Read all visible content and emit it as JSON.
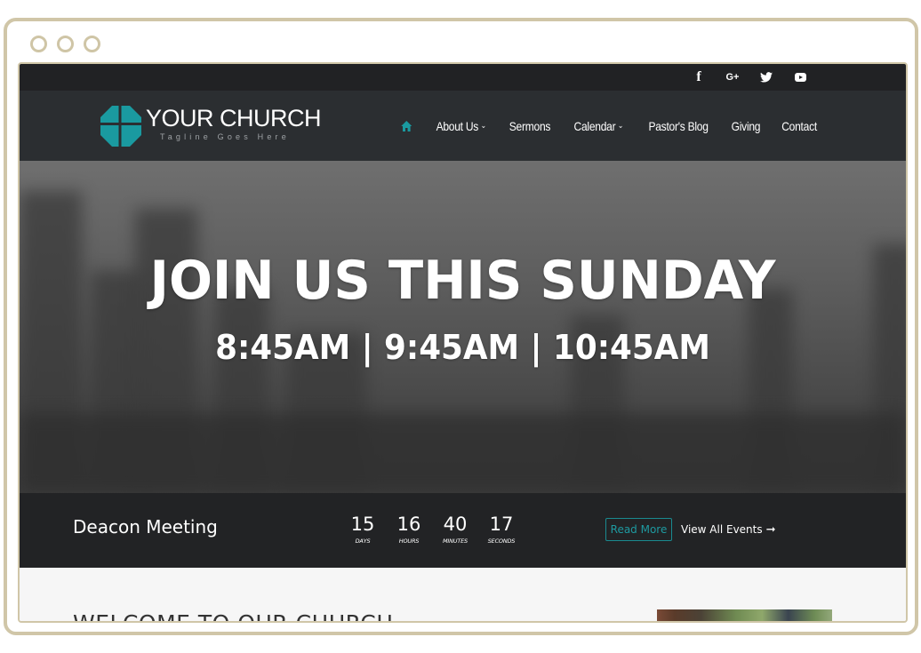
{
  "window": {
    "controls": [
      "dot-1",
      "dot-2",
      "dot-3"
    ]
  },
  "social": {
    "icons": [
      {
        "name": "facebook-icon",
        "glyph": "f"
      },
      {
        "name": "google-plus-icon",
        "glyph": "G+"
      },
      {
        "name": "twitter-icon",
        "glyph": "bird"
      },
      {
        "name": "youtube-icon",
        "glyph": "play"
      }
    ]
  },
  "brand": {
    "title": "YOUR CHURCH",
    "tagline": "Tagline Goes Here",
    "accent_color": "#1a9aa0"
  },
  "nav": {
    "home_icon": "home-icon",
    "items": [
      {
        "label": "About Us",
        "has_dropdown": true,
        "caret": "⌄"
      },
      {
        "label": "Sermons",
        "has_dropdown": false
      },
      {
        "label": "Calendar",
        "has_dropdown": true,
        "caret": "⌄"
      },
      {
        "label": "Pastor's Blog",
        "has_dropdown": false
      },
      {
        "label": "Giving",
        "has_dropdown": false
      },
      {
        "label": "Contact",
        "has_dropdown": false
      }
    ]
  },
  "hero": {
    "title": "JOIN US THIS SUNDAY",
    "times": "8:45AM | 9:45AM | 10:45AM"
  },
  "event": {
    "title": "Deacon Meeting",
    "countdown": [
      {
        "value": "15",
        "label": "Days"
      },
      {
        "value": "16",
        "label": "Hours"
      },
      {
        "value": "40",
        "label": "Minutes"
      },
      {
        "value": "17",
        "label": "Seconds"
      }
    ],
    "read_more_label": "Read More",
    "view_all_label": "View All Events",
    "view_all_arrow": "➞"
  },
  "welcome": {
    "title": "WELCOME TO OUR CHURCH"
  }
}
